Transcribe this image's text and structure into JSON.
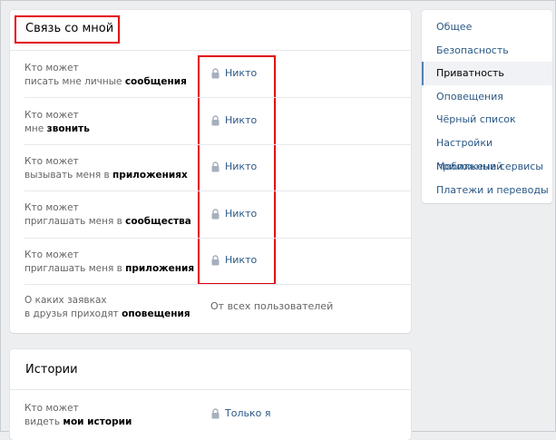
{
  "contact": {
    "title": "Связь со мной",
    "rows": [
      {
        "line1": "Кто может",
        "line2_plain": "писать мне личные ",
        "line2_bold": "сообщения",
        "value": "Никто"
      },
      {
        "line1": "Кто может",
        "line2_plain": "мне ",
        "line2_bold": "звонить",
        "value": "Никто"
      },
      {
        "line1": "Кто может",
        "line2_plain": "вызывать меня в ",
        "line2_bold": "приложениях",
        "value": "Никто"
      },
      {
        "line1": "Кто может",
        "line2_plain": "приглашать меня в ",
        "line2_bold": "сообщества",
        "value": "Никто"
      },
      {
        "line1": "Кто может",
        "line2_plain": "приглашать меня в ",
        "line2_bold": "приложения",
        "value": "Никто"
      }
    ],
    "friend_requests": {
      "line1": "О каких заявках",
      "line2_plain": "в друзья приходят ",
      "line2_bold": "оповещения",
      "value": "От всех пользователей"
    }
  },
  "stories": {
    "title": "Истории",
    "row": {
      "line1": "Кто может",
      "line2_plain": "видеть ",
      "line2_bold": "мои истории",
      "value": "Только я"
    }
  },
  "menu": {
    "items": [
      {
        "label": "Общее"
      },
      {
        "label": "Безопасность"
      },
      {
        "label": "Приватность"
      },
      {
        "label": "Оповещения"
      },
      {
        "label": "Чёрный список"
      },
      {
        "label": "Настройки приложений"
      },
      {
        "label": "Мобильные сервисы"
      },
      {
        "label": "Платежи и переводы"
      }
    ],
    "active_index": 2
  },
  "icons": {
    "lock": "lock-icon"
  },
  "colors": {
    "highlight": "#e2000b",
    "link": "#2a5885",
    "active_marker": "#5181b8"
  }
}
